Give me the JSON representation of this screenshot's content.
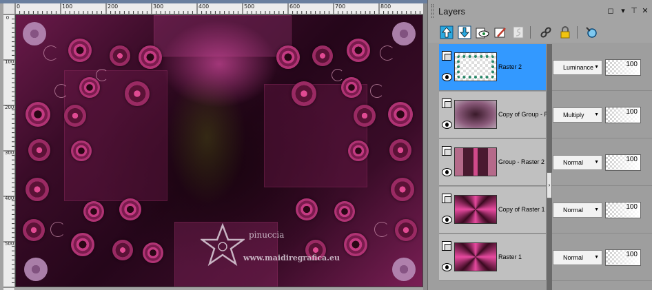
{
  "rulers": {
    "top_labels": [
      "0",
      "100",
      "200",
      "300",
      "400",
      "500",
      "600",
      "700",
      "800"
    ],
    "left_labels": [
      "0",
      "100",
      "200",
      "300",
      "400",
      "500"
    ]
  },
  "watermark": {
    "name": "pinuccia",
    "url": "www.maidiregrafica.eu"
  },
  "layers_panel": {
    "title": "Layers",
    "controls": {
      "restore": "◻",
      "menu": "▾",
      "pin": "⊤",
      "close": "✕"
    },
    "toolbar_icons": [
      "move-layer-up-icon",
      "move-layer-down-icon",
      "visibility-toggle-icon",
      "edit-layer-icon",
      "mask-icon",
      "link-icon",
      "lock-icon",
      "layer-properties-icon"
    ],
    "layers": [
      {
        "name": "Raster 2",
        "blend_mode": "Luminance",
        "opacity": "100",
        "selected": true
      },
      {
        "name": "Copy of Group - R",
        "blend_mode": "Multiply",
        "opacity": "100",
        "selected": false
      },
      {
        "name": "Group - Raster 2",
        "blend_mode": "Normal",
        "opacity": "100",
        "selected": false
      },
      {
        "name": "Copy of Raster 1",
        "blend_mode": "Normal",
        "opacity": "100",
        "selected": false
      },
      {
        "name": "Raster 1",
        "blend_mode": "Normal",
        "opacity": "100",
        "selected": false
      }
    ]
  },
  "colors": {
    "selection": "#3399ff",
    "canvas_pink": "#c43a82",
    "canvas_dark": "#25061a"
  }
}
